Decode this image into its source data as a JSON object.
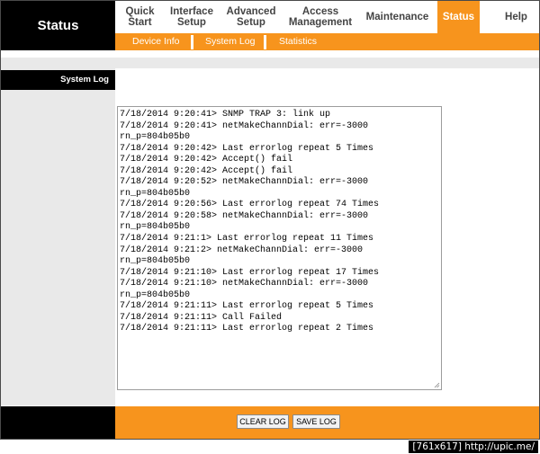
{
  "header": {
    "title": "Status"
  },
  "nav": {
    "items": [
      {
        "line1": "Quick",
        "line2": "Start"
      },
      {
        "line1": "Interface",
        "line2": "Setup"
      },
      {
        "line1": "Advanced",
        "line2": "Setup"
      },
      {
        "line1": "Access",
        "line2": "Management"
      },
      {
        "line1": "Maintenance",
        "line2": ""
      },
      {
        "line1": "Status",
        "line2": ""
      },
      {
        "line1": "Help",
        "line2": ""
      }
    ],
    "active": "Status"
  },
  "subnav": {
    "items": [
      "Device Info",
      "System Log",
      "Statistics"
    ]
  },
  "section": {
    "label": "System Log"
  },
  "log": {
    "lines": [
      "7/18/2014 9:20:41> SNMP TRAP 3: link up",
      "7/18/2014 9:20:41> netMakeChannDial: err=-3000",
      "rn_p=804b05b0",
      "7/18/2014 9:20:42> Last errorlog repeat 5 Times",
      "7/18/2014 9:20:42> Accept() fail",
      "7/18/2014 9:20:42> Accept() fail",
      "7/18/2014 9:20:52> netMakeChannDial: err=-3000",
      "rn_p=804b05b0",
      "7/18/2014 9:20:56> Last errorlog repeat 74 Times",
      "7/18/2014 9:20:58> netMakeChannDial: err=-3000",
      "rn_p=804b05b0",
      "7/18/2014 9:21:1> Last errorlog repeat 11 Times",
      "7/18/2014 9:21:2> netMakeChannDial: err=-3000",
      "rn_p=804b05b0",
      "7/18/2014 9:21:10> Last errorlog repeat 17 Times",
      "7/18/2014 9:21:10> netMakeChannDial: err=-3000",
      "rn_p=804b05b0",
      "7/18/2014 9:21:11> Last errorlog repeat 5 Times",
      "7/18/2014 9:21:11> Call Failed",
      "7/18/2014 9:21:11> Last errorlog repeat 2 Times"
    ]
  },
  "buttons": {
    "clear": "CLEAR LOG",
    "save": "SAVE LOG"
  },
  "watermark": "[761x617] http://upic.me/",
  "colors": {
    "accent": "#f7941d",
    "dark": "#000000",
    "panel": "#e9e9e9"
  }
}
